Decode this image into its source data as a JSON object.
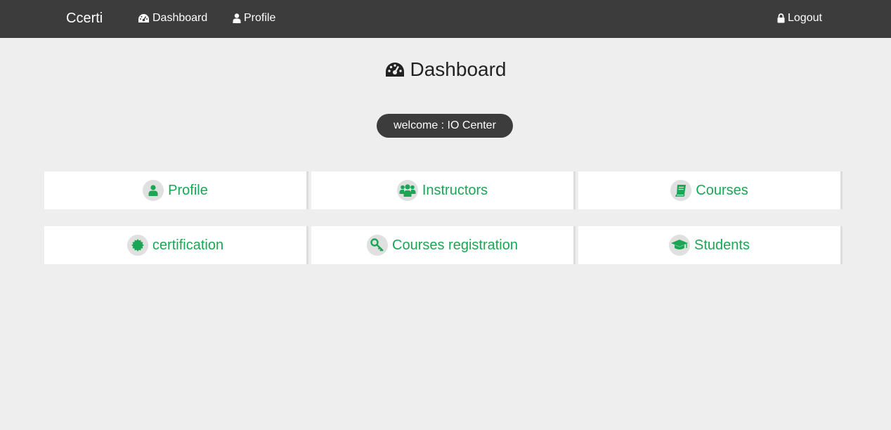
{
  "navbar": {
    "brand": "Ccerti",
    "links": [
      {
        "label": "Dashboard",
        "icon": "dashboard-icon"
      },
      {
        "label": "Profile",
        "icon": "user-icon"
      }
    ],
    "logout": {
      "label": "Logout",
      "icon": "lock-icon"
    }
  },
  "main": {
    "title": "Dashboard",
    "title_icon": "dashboard-icon",
    "welcome": "welcome : IO Center",
    "tiles": [
      {
        "label": "Profile",
        "icon": "user-icon"
      },
      {
        "label": "Instructors",
        "icon": "users-icon"
      },
      {
        "label": "Courses",
        "icon": "book-icon"
      },
      {
        "label": "certification",
        "icon": "certificate-icon"
      },
      {
        "label": "Courses registration",
        "icon": "key-icon"
      },
      {
        "label": "Students",
        "icon": "graduation-cap-icon"
      }
    ]
  },
  "colors": {
    "navbar": "#3c3c3c",
    "background": "#eeeeee",
    "accent": "#1aa655",
    "tile_icon_bg": "#e0e0e0"
  }
}
